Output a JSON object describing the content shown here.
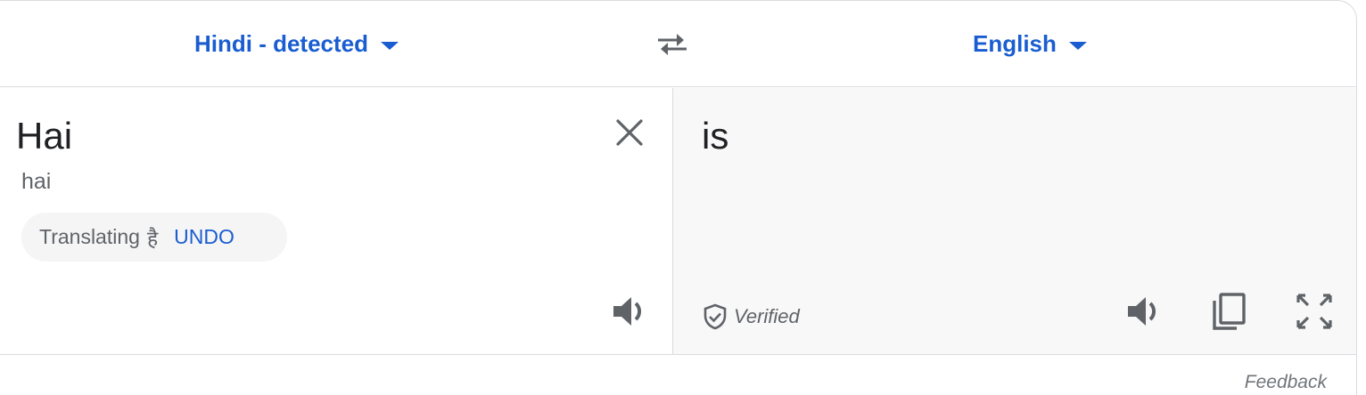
{
  "languages": {
    "source": "Hindi - detected",
    "target": "English"
  },
  "source": {
    "text": "Hai",
    "transliteration": "hai",
    "suggestion": {
      "prefix": "Translating",
      "word": "है",
      "undo_label": "UNDO"
    }
  },
  "target": {
    "text": "is",
    "verified_label": "Verified"
  },
  "footer": {
    "feedback_label": "Feedback"
  },
  "colors": {
    "accent": "#1a5dd1",
    "icon": "#5f6368",
    "border": "#dadce0",
    "target_bg": "#f8f8f8"
  },
  "icons": [
    "caret-down-icon",
    "swap-arrows-icon",
    "close-icon",
    "speaker-icon",
    "shield-check-icon",
    "copy-icon",
    "fullscreen-icon"
  ]
}
